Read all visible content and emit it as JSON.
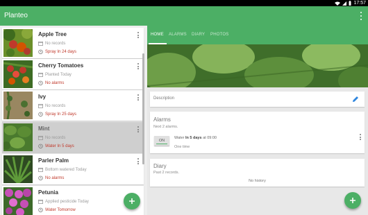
{
  "status_bar": {
    "time": "17:57"
  },
  "app": {
    "title": "Planteo"
  },
  "plants": [
    {
      "name": "Apple Tree",
      "line1": "No records",
      "line2": "Spray In 24 days",
      "photo": "apple-tree"
    },
    {
      "name": "Cherry Tomatoes",
      "line1": "Planted Today",
      "line2": "No alarms",
      "photo": "cherry-tomatoes"
    },
    {
      "name": "Ivy",
      "line1": "No records",
      "line2": "Spray In 25 days",
      "photo": "ivy"
    },
    {
      "name": "Mint",
      "line1": "No records",
      "line2": "Water In 5 days",
      "photo": "mint"
    },
    {
      "name": "Parler Palm",
      "line1": "Bottom watered Today",
      "line2": "No alarms",
      "photo": "parlor-palm"
    },
    {
      "name": "Petunia",
      "line1": "Applied pesticide Today",
      "line2": "Water Tomorrow",
      "photo": "petunia"
    }
  ],
  "selected_plant_index": 3,
  "tabs": [
    {
      "label": "HOME",
      "active": true
    },
    {
      "label": "ALARMS",
      "active": false
    },
    {
      "label": "DIARY",
      "active": false
    },
    {
      "label": "PHOTOS",
      "active": false
    }
  ],
  "description": {
    "label": "Description"
  },
  "alarms": {
    "title": "Alarms",
    "subtitle": "Next 2 alarms.",
    "toggle_label": "ON",
    "alarm_action": "Water",
    "alarm_when": "In 5 days",
    "alarm_time": "at 09:00",
    "repeat": "One time"
  },
  "diary": {
    "title": "Diary",
    "subtitle": "Past 2 records.",
    "empty": "No history"
  },
  "colors": {
    "accent": "#4caf65",
    "alert": "#c0392b"
  },
  "icons": [
    "wifi-icon",
    "signal-icon",
    "battery-icon",
    "overflow-menu-icon",
    "calendar-icon",
    "alarm-clock-icon",
    "pencil-icon",
    "add-icon"
  ]
}
